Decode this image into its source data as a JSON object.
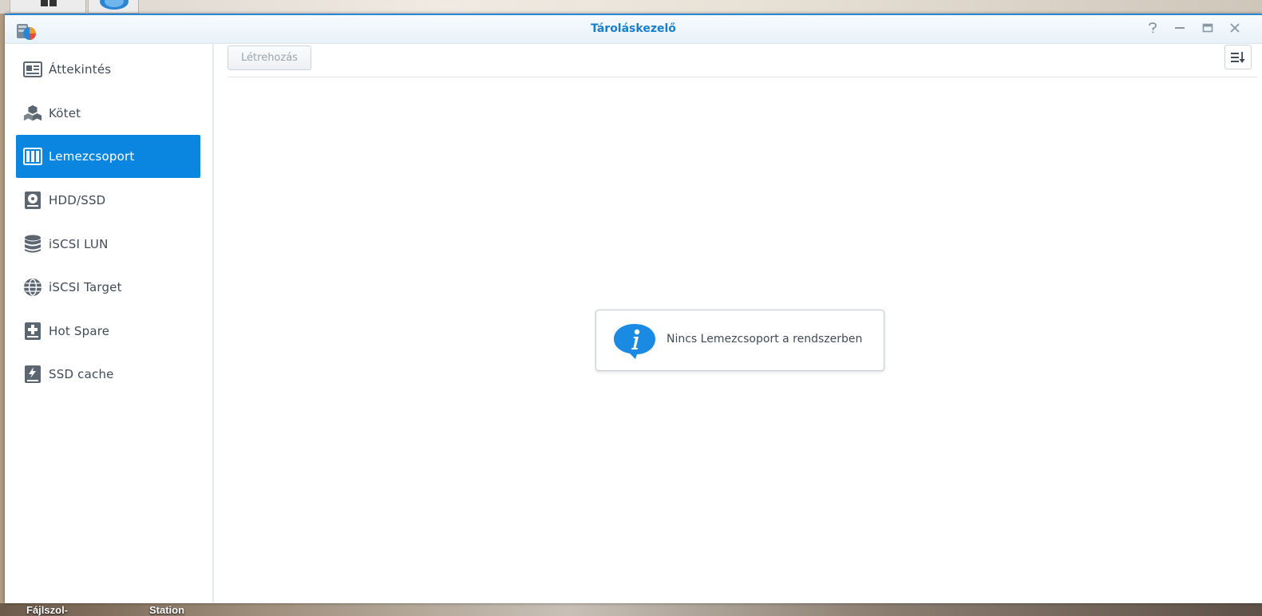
{
  "window": {
    "title": "Tároláskezelő",
    "controls": [
      "help-icon",
      "minimize-icon",
      "maximize-icon",
      "close-icon"
    ]
  },
  "sidebar": {
    "items": [
      {
        "label": "Áttekintés",
        "icon": "overview-card-icon",
        "active": false
      },
      {
        "label": "Kötet",
        "icon": "volume-cubes-icon",
        "active": false
      },
      {
        "label": "Lemezcsoport",
        "icon": "disk-group-icon",
        "active": true
      },
      {
        "label": "HDD/SSD",
        "icon": "hdd-icon",
        "active": false
      },
      {
        "label": "iSCSI LUN",
        "icon": "database-icon",
        "active": false
      },
      {
        "label": "iSCSI Target",
        "icon": "globe-icon",
        "active": false
      },
      {
        "label": "Hot Spare",
        "icon": "hot-spare-plus-icon",
        "active": false
      },
      {
        "label": "SSD cache",
        "icon": "ssd-cache-bolt-icon",
        "active": false
      }
    ]
  },
  "toolbar": {
    "create_label": "Létrehozás",
    "sort_icon": "sort-icon"
  },
  "main": {
    "empty_message": "Nincs Lemezcsoport a rendszerben",
    "empty_icon": "info-icon"
  },
  "desktop": {
    "labels": [
      "Fájlszol-",
      "Station"
    ]
  },
  "colors": {
    "accent": "#0a86e0",
    "title": "#1a7ec8"
  }
}
